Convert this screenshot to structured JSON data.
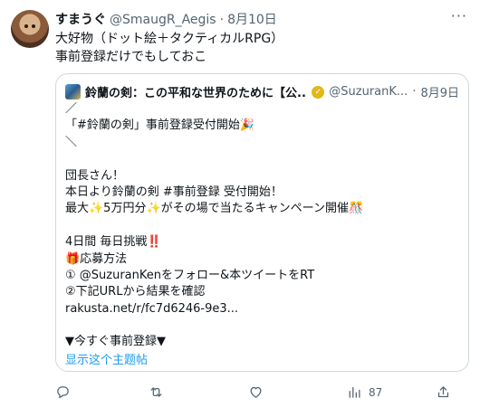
{
  "tweet": {
    "display_name": "すまうぐ",
    "handle": "@SmaugR_Aegis",
    "separator": "·",
    "date": "8月10日",
    "more": "···",
    "body_lines": [
      "大好物（ドット絵＋タクティカルRPG）",
      "事前登録だけでもしておこ"
    ]
  },
  "quote": {
    "name": "鈴蘭の剣：この平和な世界のために【公...",
    "handle": "@SuzuranK...",
    "separator": "·",
    "date": "8月9日",
    "lines": [
      "／",
      "「#鈴蘭の剣」事前登録受付開始🎉",
      "＼",
      "",
      "団長さん！",
      "本日より鈴蘭の剣 #事前登録 受付開始！",
      "最大✨5万円分✨がその場で当たるキャンペーン開催🎊",
      "",
      "4日間 毎日挑戦‼️",
      "🎁応募方法",
      "① @SuzuranKenをフォロー&本ツイートをRT",
      "②下記URLから結果を確認",
      "rakusta.net/r/fc7d6246-9e3...",
      "",
      "▼今すぐ事前登録▼"
    ],
    "show_thread": "显示这个主题帖"
  },
  "actions": {
    "reply_count": "",
    "retweet_count": "",
    "like_count": "",
    "views_count": "87"
  },
  "colors": {
    "text": "#0f1419",
    "secondary": "#536471",
    "link": "#1d9bf0",
    "border": "#cfd9de"
  }
}
